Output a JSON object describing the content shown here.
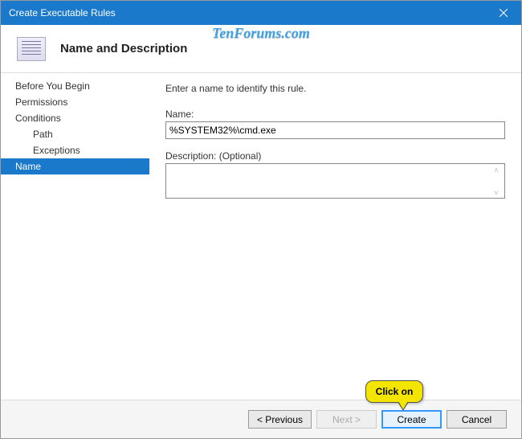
{
  "window": {
    "title": "Create Executable Rules"
  },
  "watermark": "TenForums.com",
  "header": {
    "title": "Name and Description"
  },
  "sidebar": {
    "items": [
      {
        "label": "Before You Begin",
        "indent": false,
        "selected": false
      },
      {
        "label": "Permissions",
        "indent": false,
        "selected": false
      },
      {
        "label": "Conditions",
        "indent": false,
        "selected": false
      },
      {
        "label": "Path",
        "indent": true,
        "selected": false
      },
      {
        "label": "Exceptions",
        "indent": true,
        "selected": false
      },
      {
        "label": "Name",
        "indent": false,
        "selected": true
      }
    ]
  },
  "content": {
    "instruction": "Enter a name to identify this rule.",
    "name_label": "Name:",
    "name_value": "%SYSTEM32%\\cmd.exe",
    "desc_label": "Description: (Optional)",
    "desc_value": ""
  },
  "footer": {
    "previous": "< Previous",
    "next": "Next >",
    "create": "Create",
    "cancel": "Cancel"
  },
  "callout": {
    "text": "Click on"
  }
}
